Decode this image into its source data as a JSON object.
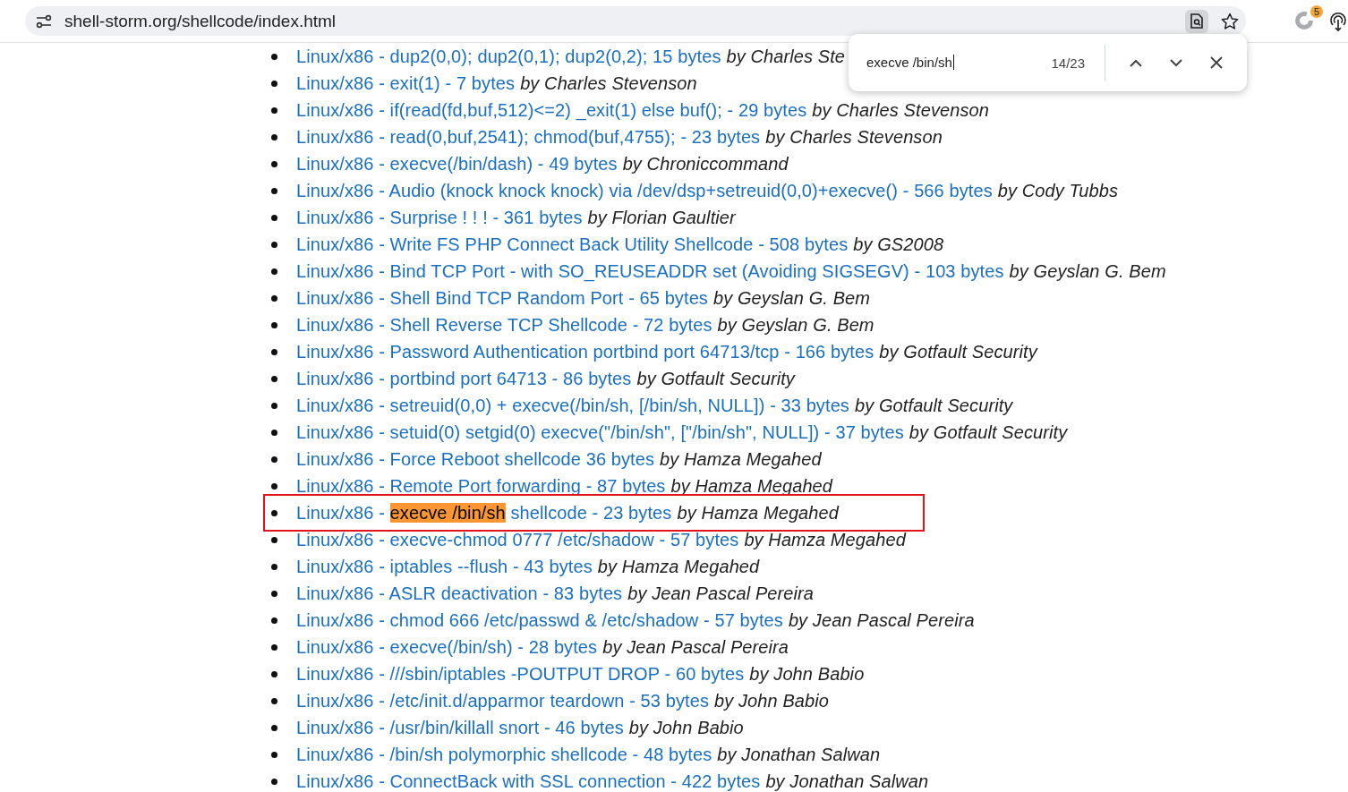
{
  "address_bar": {
    "url": "shell-storm.org/shellcode/index.html"
  },
  "extension_badge": "5",
  "find_bar": {
    "query": "execve /bin/sh",
    "count": "14/23"
  },
  "items": [
    {
      "kind": "plain",
      "link": "Linux/x86 - dup2(0,0); dup2(0,1); dup2(0,2); 15 bytes",
      "author": "by Charles Ste",
      "boxed": false
    },
    {
      "kind": "plain",
      "link": "Linux/x86 - exit(1) - 7 bytes",
      "author": "by Charles Stevenson",
      "boxed": false
    },
    {
      "kind": "plain",
      "link": "Linux/x86 - if(read(fd,buf,512)<=2) _exit(1) else buf(); - 29 bytes",
      "author": "by Charles Stevenson",
      "boxed": false
    },
    {
      "kind": "plain",
      "link": "Linux/x86 - read(0,buf,2541); chmod(buf,4755); - 23 bytes",
      "author": "by Charles Stevenson",
      "boxed": false
    },
    {
      "kind": "plain",
      "link": "Linux/x86 - execve(/bin/dash) - 49 bytes",
      "author": "by Chroniccommand",
      "boxed": false
    },
    {
      "kind": "plain",
      "link": "Linux/x86 - Audio (knock knock knock) via /dev/dsp+setreuid(0,0)+execve() - 566 bytes",
      "author": "by Cody Tubbs",
      "boxed": false
    },
    {
      "kind": "plain",
      "link": "Linux/x86 - Surprise ! ! ! - 361 bytes",
      "author": "by Florian Gaultier",
      "boxed": false
    },
    {
      "kind": "plain",
      "link": "Linux/x86 - Write FS PHP Connect Back Utility Shellcode - 508 bytes",
      "author": "by GS2008",
      "boxed": false
    },
    {
      "kind": "plain",
      "link": "Linux/x86 - Bind TCP Port - with SO_REUSEADDR set (Avoiding SIGSEGV) - 103 bytes",
      "author": "by Geyslan G. Bem",
      "boxed": false
    },
    {
      "kind": "plain",
      "link": "Linux/x86 - Shell Bind TCP Random Port - 65 bytes",
      "author": "by Geyslan G. Bem",
      "boxed": false
    },
    {
      "kind": "plain",
      "link": "Linux/x86 - Shell Reverse TCP Shellcode - 72 bytes",
      "author": "by Geyslan G. Bem",
      "boxed": false
    },
    {
      "kind": "plain",
      "link": "Linux/x86 - Password Authentication portbind port 64713/tcp - 166 bytes",
      "author": "by Gotfault Security",
      "boxed": false
    },
    {
      "kind": "plain",
      "link": "Linux/x86 - portbind port 64713 - 86 bytes",
      "author": "by Gotfault Security",
      "boxed": false
    },
    {
      "kind": "plain",
      "link": "Linux/x86 - setreuid(0,0) + execve(/bin/sh, [/bin/sh, NULL]) - 33 bytes",
      "author": "by Gotfault Security",
      "boxed": false
    },
    {
      "kind": "plain",
      "link": "Linux/x86 - setuid(0) setgid(0) execve(\"/bin/sh\", [\"/bin/sh\", NULL]) - 37 bytes",
      "author": "by Gotfault Security",
      "boxed": false
    },
    {
      "kind": "plain",
      "link": "Linux/x86 - Force Reboot shellcode 36 bytes",
      "author": "by Hamza Megahed",
      "boxed": false
    },
    {
      "kind": "plain",
      "link": "Linux/x86 - Remote Port forwarding - 87 bytes",
      "author": "by Hamza Megahed",
      "boxed": false
    },
    {
      "kind": "match",
      "before": "Linux/x86 - ",
      "match": "execve /bin/sh",
      "after": " shellcode - 23 bytes",
      "author": "by Hamza Megahed",
      "boxed": true
    },
    {
      "kind": "plain",
      "link": "Linux/x86 - execve-chmod 0777 /etc/shadow - 57 bytes",
      "author": "by Hamza Megahed",
      "boxed": false
    },
    {
      "kind": "plain",
      "link": "Linux/x86 - iptables --flush - 43 bytes",
      "author": "by Hamza Megahed",
      "boxed": false
    },
    {
      "kind": "plain",
      "link": "Linux/x86 - ASLR deactivation - 83 bytes",
      "author": "by Jean Pascal Pereira",
      "boxed": false
    },
    {
      "kind": "plain",
      "link": "Linux/x86 - chmod 666 /etc/passwd & /etc/shadow - 57 bytes",
      "author": "by Jean Pascal Pereira",
      "boxed": false
    },
    {
      "kind": "plain",
      "link": "Linux/x86 - execve(/bin/sh) - 28 bytes",
      "author": "by Jean Pascal Pereira",
      "boxed": false
    },
    {
      "kind": "plain",
      "link": "Linux/x86 - ///sbin/iptables -POUTPUT DROP - 60 bytes",
      "author": "by John Babio",
      "boxed": false
    },
    {
      "kind": "plain",
      "link": "Linux/x86 - /etc/init.d/apparmor teardown - 53 bytes",
      "author": "by John Babio",
      "boxed": false
    },
    {
      "kind": "plain",
      "link": "Linux/x86 - /usr/bin/killall snort - 46 bytes",
      "author": "by John Babio",
      "boxed": false
    },
    {
      "kind": "plain",
      "link": "Linux/x86 - /bin/sh polymorphic shellcode - 48 bytes",
      "author": "by Jonathan Salwan",
      "boxed": false
    },
    {
      "kind": "plain",
      "link": "Linux/x86 - ConnectBack with SSL connection - 422 bytes",
      "author": "by Jonathan Salwan",
      "boxed": false
    }
  ]
}
